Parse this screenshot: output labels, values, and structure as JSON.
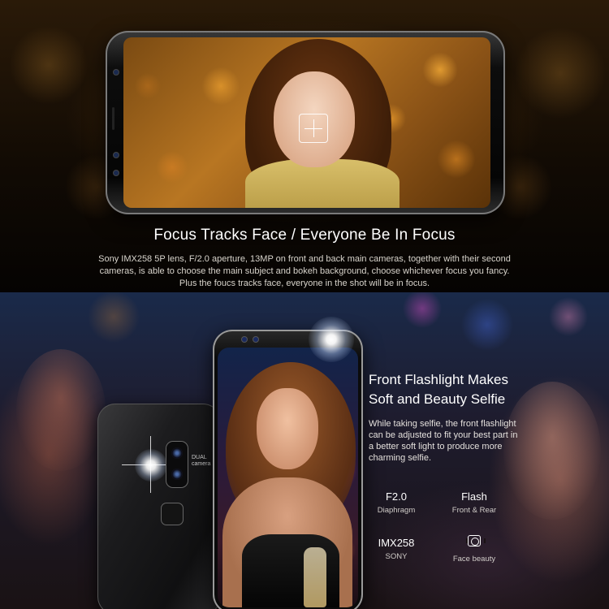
{
  "section1": {
    "headline": "Focus Tracks Face / Everyone Be In Focus",
    "description": "Sony IMX258 5P lens, F/2.0 aperture, 13MP on front and back main cameras, together with their second cameras, is able to choose the main subject and bokeh background, choose whichever focus you fancy. Plus the foucs tracks face, everyone in the shot will be in focus."
  },
  "section2": {
    "headline_line1": "Front Flashlight Makes",
    "headline_line2": "Soft and Beauty Selfie",
    "description": "While taking selfie, the front flashlight can be adjusted to fit your best part in a better soft light to produce more charming selfie.",
    "camera_label_line1": "DUAL",
    "camera_label_line2": "camera",
    "specs": [
      {
        "value": "F2.0",
        "label": "Diaphragm"
      },
      {
        "value": "Flash",
        "label": "Front & Rear"
      },
      {
        "value": "IMX258",
        "label": "SONY"
      },
      {
        "icon": "face-beauty-icon",
        "label": "Face beauty"
      }
    ]
  }
}
